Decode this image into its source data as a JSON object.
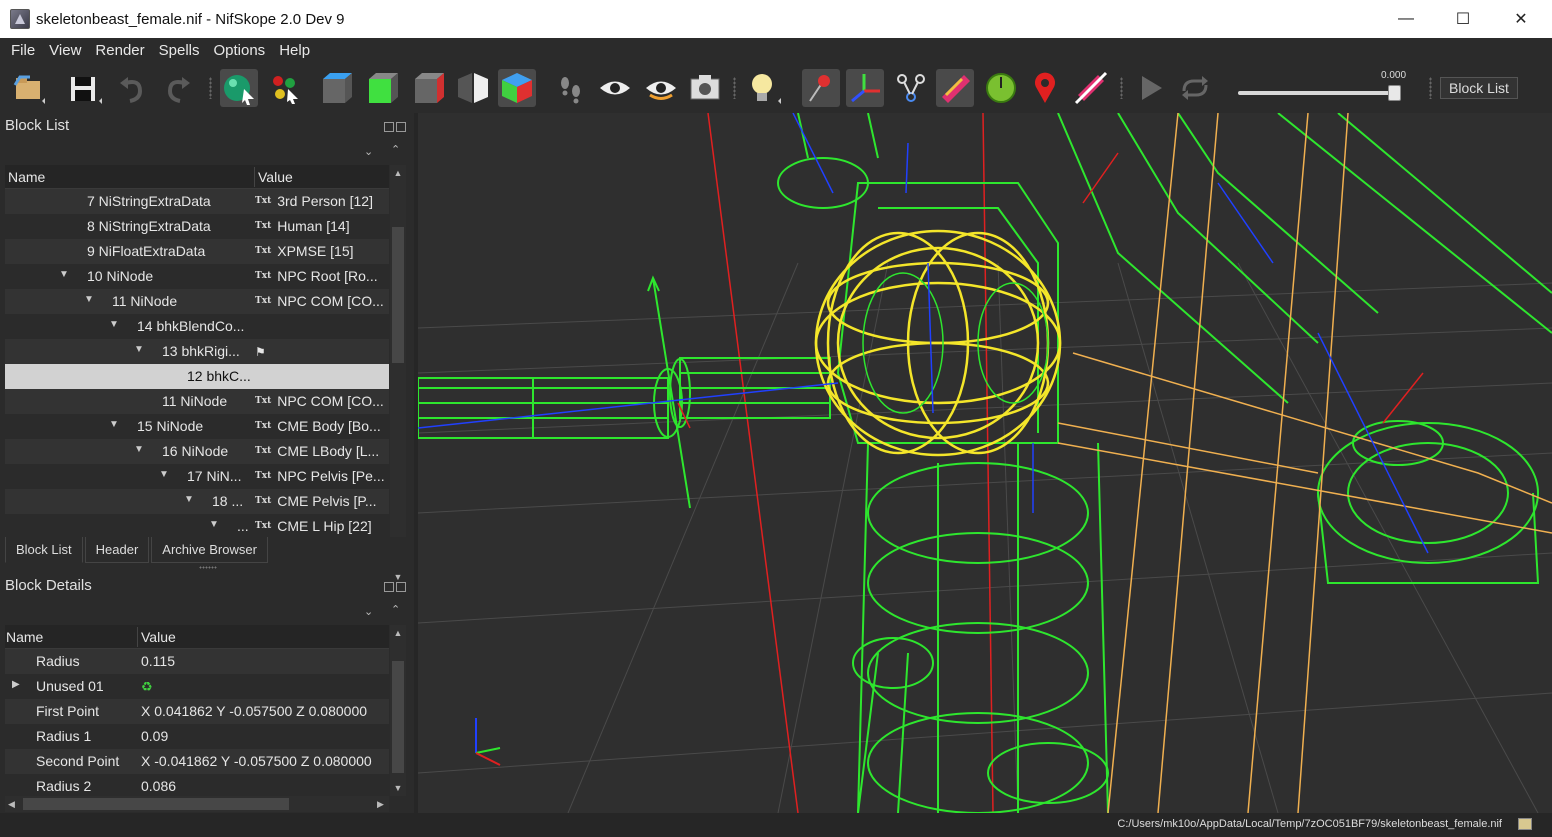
{
  "window": {
    "title": "skeletonbeast_female.nif - NifSkope 2.0 Dev 9",
    "minimize": "—",
    "maximize": "☐",
    "close": "✕"
  },
  "menu": [
    "File",
    "View",
    "Render",
    "Spells",
    "Options",
    "Help"
  ],
  "toolbar": {
    "animation_time": "0.000",
    "animation_progress": 1.0,
    "block_list_button": "Block List"
  },
  "block_list": {
    "title": "Block List",
    "columns": [
      "Name",
      "Value"
    ],
    "rows": [
      {
        "name": "7 NiStringExtraData",
        "value": "3rd Person [12]",
        "depth": 0,
        "expand": "",
        "txt": "Txt"
      },
      {
        "name": "8 NiStringExtraData",
        "value": "Human [14]",
        "depth": 0,
        "expand": "",
        "txt": "Txt"
      },
      {
        "name": "9 NiFloatExtraData",
        "value": "XPMSE [15]",
        "depth": 0,
        "expand": "",
        "txt": "Txt"
      },
      {
        "name": "10 NiNode",
        "value": "NPC Root [Ro...",
        "depth": 0,
        "expand": "▼",
        "txt": "Txt"
      },
      {
        "name": "11 NiNode",
        "value": "NPC COM [CO...",
        "depth": 1,
        "expand": "▼",
        "txt": "Txt"
      },
      {
        "name": "14 bhkBlendCo...",
        "value": "",
        "depth": 2,
        "expand": "▼",
        "txt": ""
      },
      {
        "name": "13 bhkRigi...",
        "value": "",
        "depth": 3,
        "expand": "▼",
        "txt": "",
        "flag": true
      },
      {
        "name": "12 bhkC...",
        "value": "",
        "depth": 4,
        "expand": "",
        "txt": "",
        "selected": true
      },
      {
        "name": "11 NiNode",
        "value": "NPC COM [CO...",
        "depth": 3,
        "expand": "",
        "txt": "Txt"
      },
      {
        "name": "15 NiNode",
        "value": "CME Body [Bo...",
        "depth": 2,
        "expand": "▼",
        "txt": "Txt"
      },
      {
        "name": "16 NiNode",
        "value": "CME LBody [L...",
        "depth": 3,
        "expand": "▼",
        "txt": "Txt"
      },
      {
        "name": "17 NiN...",
        "value": "NPC Pelvis [Pe...",
        "depth": 4,
        "expand": "▼",
        "txt": "Txt"
      },
      {
        "name": "18 ...",
        "value": "CME Pelvis [P...",
        "depth": 5,
        "expand": "▼",
        "txt": "Txt"
      },
      {
        "name": "...",
        "value": "CME L Hip [22]",
        "depth": 6,
        "expand": "▼",
        "txt": "Txt"
      }
    ]
  },
  "tabs": [
    "Block List",
    "Header",
    "Archive Browser"
  ],
  "block_details": {
    "title": "Block Details",
    "columns": [
      "Name",
      "Value"
    ],
    "rows": [
      {
        "name": "Radius",
        "value": "0.115",
        "expand": ""
      },
      {
        "name": "Unused 01",
        "value": "",
        "expand": "▶",
        "icon": true
      },
      {
        "name": "First Point",
        "value": "X 0.041862 Y -0.057500 Z 0.080000",
        "expand": ""
      },
      {
        "name": "Radius 1",
        "value": "0.09",
        "expand": ""
      },
      {
        "name": "Second Point",
        "value": "X -0.041862 Y -0.057500 Z 0.080000",
        "expand": ""
      },
      {
        "name": "Radius 2",
        "value": "0.086",
        "expand": ""
      }
    ]
  },
  "status": {
    "path": "C:/Users/mk10o/AppData/Local/Temp/7zOC051BF79/skeletonbeast_female.nif"
  },
  "colors": {
    "wire_green": "#2ee62e",
    "wire_yellow": "#f4e62a",
    "wire_orange": "#f0b050",
    "axis_red": "#e02020",
    "axis_blue": "#2040ff"
  }
}
